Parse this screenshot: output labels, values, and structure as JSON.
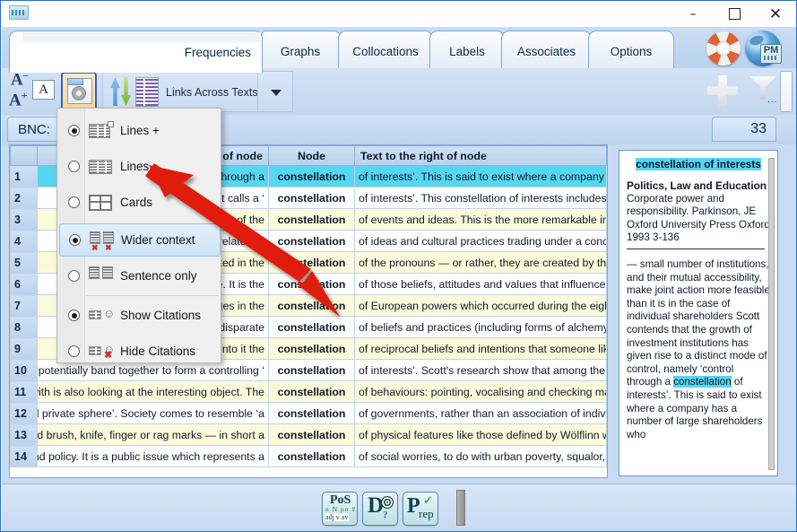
{
  "window": {
    "minimize_label": "–",
    "maximize_label": "",
    "close_label": "✕"
  },
  "ribbon": {
    "tabs": [
      {
        "label": "Frequencies",
        "active": true
      },
      {
        "label": "Graphs",
        "active": false
      },
      {
        "label": "Collocations",
        "active": false
      },
      {
        "label": "Labels",
        "active": false
      },
      {
        "label": "Associates",
        "active": false
      },
      {
        "label": "Options",
        "active": false
      }
    ],
    "help_icon": "lifesaver-icon",
    "web_icon": "globe-icon",
    "web_badge": "PM",
    "font_decrease": "A",
    "font_increase": "A",
    "font_box": "A",
    "view_button": "view-settings-button",
    "links_label": "Links Across Texts",
    "dropdown_icon": "chevron-down-icon",
    "add_icon": "plus-icon",
    "filter_icon": "funnel-icon"
  },
  "statusbar": {
    "corpus_label": "BNC:",
    "hit_count": "33"
  },
  "menu": {
    "items": [
      {
        "label": "Lines +",
        "selected": true,
        "icon": "lines-plus-icon",
        "highlighted": false
      },
      {
        "label": "Lines",
        "selected": false,
        "icon": "lines-icon",
        "highlighted": false
      },
      {
        "label": "Cards",
        "selected": false,
        "icon": "cards-icon",
        "highlighted": false
      },
      {
        "label": "Wider context",
        "selected": true,
        "icon": "wider-context-icon",
        "highlighted": true
      },
      {
        "label": "Sentence only",
        "selected": false,
        "icon": "sentence-only-icon",
        "highlighted": false
      },
      {
        "label": "Show Citations",
        "selected": true,
        "icon": "show-citations-icon",
        "highlighted": false
      },
      {
        "label": "Hide Citations",
        "selected": false,
        "icon": "hide-citations-icon",
        "highlighted": false
      }
    ]
  },
  "table": {
    "headers": {
      "num": "",
      "left": "Text to the left of node",
      "node": "Node",
      "right": "Text to the right of node"
    },
    "rows": [
      {
        "n": "1",
        "left": "se that control through a",
        "node": "constellation",
        "right": "of interests’. This is said to exist where a company has",
        "state": "selected"
      },
      {
        "n": "2",
        "left": "or what Scott calls a ‘",
        "node": "constellation",
        "right": "of interests’. This constellation of interests includes ent",
        "state": "odd"
      },
      {
        "n": "3",
        "left": "onal advantage of the",
        "node": "constellation",
        "right": "of events and ideas. This is the more remarkable in view",
        "state": "even"
      },
      {
        "n": "4",
        "left": "olutions to relate the",
        "node": "constellation",
        "right": "of ideas and cultural practices trading under a concepti",
        "state": "odd"
      },
      {
        "n": "5",
        "left": "mar is reflected in the",
        "node": "constellation",
        "right": "of the pronouns — or rather, they are created by the p",
        "state": "even"
      },
      {
        "n": "6",
        "left": "Culture. It is the",
        "node": "constellation",
        "right": "of those beliefs, attitudes and values that influence sub",
        "state": "odd"
      },
      {
        "n": "7",
        "left": "oslo the changes in the",
        "node": "constellation",
        "right": "of European powers which occurred during the eightee",
        "state": "even"
      },
      {
        "n": "8",
        "left": "orate somewhat disparate",
        "node": "constellation",
        "right": "of beliefs and practices (including forms of alchemy and",
        "state": "odd"
      },
      {
        "n": "9",
        "left": "no reading into it the",
        "node": "constellation",
        "right": "of reciprocal beliefs and intentions that someone like Le",
        "state": "even"
      },
      {
        "n": "10",
        "left": "anies) can potentially band together to form a controlling ‘",
        "node": "constellation",
        "right": "of interests’. Scott's research show that among the top",
        "state": "odd"
      },
      {
        "n": "11",
        "left": "unicated with is also looking at the interesting object. The",
        "node": "constellation",
        "right": "of behaviours: pointing, vocalising and checking may be",
        "state": "even"
      },
      {
        "n": "12",
        "left": "e public and private sphere’. Society comes to resemble ‘a",
        "node": "constellation",
        "right": "of governments, rather than an association of individua",
        "state": "odd"
      },
      {
        "n": "13",
        "left": "t; exhibited brush, knife, finger or rag marks — in short a",
        "node": "constellation",
        "right": "of physical features like those defined by Wölflinn when",
        "state": "even"
      },
      {
        "n": "14",
        "left": "r politics and policy. It is a public issue which represents a",
        "node": "constellation",
        "right": "of social worries, to do with urban poverty, squalor, ill-",
        "state": "odd"
      }
    ]
  },
  "citation": {
    "title": "constellation of interests",
    "source": "Politics, Law and Education",
    "meta": "Corporate power and responsibility. Parkinson, JE Oxford University Press Oxford 1993 3-136",
    "body_before": "— small number of institutions, and their mutual accessibility, make joint action more feasible than it is in the case of individual shareholders Scott contends that the growth of investment institutions has given rise to a distinct mode of control, namely ‘control through a ",
    "body_highlight": "constellation",
    "body_after": " of interests’. This is said to exist where a company has a number of large shareholders who"
  },
  "bottom_toolbar": {
    "buttons": [
      {
        "name": "pos-button",
        "line1": "PoS",
        "line2": "n  N pn #",
        "line3": "adj  v  av"
      },
      {
        "name": "dictionary-button",
        "letter": "D",
        "icon": "spiral-icon",
        "mark": "?"
      },
      {
        "name": "prep-button",
        "letter": "P",
        "rest": "rep",
        "mark": "✓"
      }
    ],
    "handle": "resize-handle"
  },
  "colors": {
    "selection": "#56d6f0",
    "alt_row": "#fbfbdc",
    "accent": "#3b62b5",
    "arrow": "#e01b10"
  }
}
